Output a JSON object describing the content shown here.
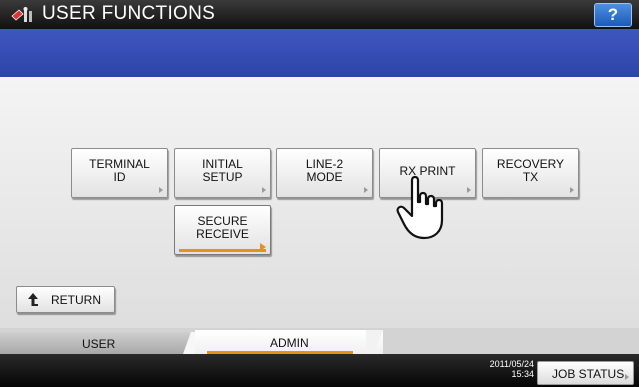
{
  "header": {
    "title": "USER FUNCTIONS",
    "help_label": "?"
  },
  "functions": [
    {
      "label": "TERMINAL\nID"
    },
    {
      "label": "INITIAL\nSETUP"
    },
    {
      "label": "LINE-2\nMODE"
    },
    {
      "label": "RX PRINT"
    },
    {
      "label": "RECOVERY\nTX"
    },
    {
      "label": "SECURE\nRECEIVE"
    }
  ],
  "return_label": "RETURN",
  "tabs": {
    "user": "USER",
    "admin": "ADMIN",
    "selected": "ADMIN"
  },
  "footer": {
    "date": "2011/05/24",
    "time": "15:34",
    "job_status": "JOB STATUS"
  },
  "colors": {
    "header": "#1c1c1c",
    "band": "#3a52b8",
    "accent": "#e8901a",
    "help": "#2a6fd0"
  }
}
